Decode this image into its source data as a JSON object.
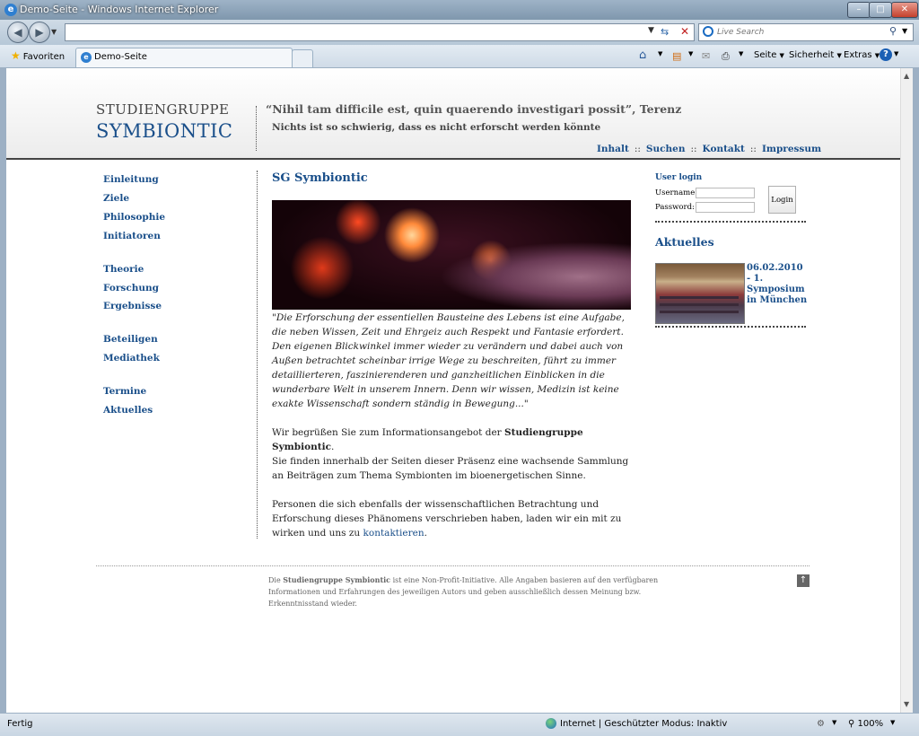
{
  "window": {
    "title": "Demo-Seite - Windows Internet Explorer",
    "search_placeholder": "Live Search",
    "favorites": "Favoriten",
    "tab_title": "Demo-Seite",
    "toolbar": {
      "seite": "Seite",
      "sicherheit": "Sicherheit",
      "extras": "Extras"
    },
    "status": {
      "left": "Fertig",
      "zone": "Internet | Geschützter Modus: Inaktiv",
      "zoom": "100%"
    }
  },
  "site": {
    "brand_top": "STUDIENGRUPPE",
    "brand_bottom": "SYMBIONTIC",
    "quote": "“Nihil tam difficile est, quin quaerendo investigari possit”, Terenz",
    "quote_translation": "Nichts ist so schwierig, dass es nicht erforscht werden könnte",
    "top_nav": [
      "Inhalt",
      "Suchen",
      "Kontakt",
      "Impressum"
    ],
    "top_nav_sep": "::"
  },
  "left_nav": {
    "group1": [
      "Einleitung",
      "Ziele",
      "Philosophie",
      "Initiatoren"
    ],
    "group2": [
      "Theorie",
      "Forschung",
      "Ergebnisse"
    ],
    "group3": [
      "Beteiligen",
      "Mediathek"
    ],
    "group4": [
      "Termine",
      "Aktuelles"
    ]
  },
  "content": {
    "title": "SG Symbiontic",
    "quote": "\"Die Erforschung der essentiellen Bausteine des Lebens ist eine Aufgabe, die neben Wissen, Zeit und Ehrgeiz auch Respekt und Fantasie erfordert. Den eigenen Blickwinkel immer wieder zu verändern und dabei auch von Außen betrachtet scheinbar irrige Wege zu beschreiten, führt zu immer detaillierteren, faszinierenderen und ganzheitlichen Einblicken in die wunderbare Welt in unserem Innern. Denn wir wissen, Medizin ist keine exakte Wissenschaft sondern ständig in Bewegung...\"",
    "welcome_pre": "Wir begrüßen Sie zum Informationsangebot der ",
    "welcome_bold": "Studiengruppe Symbiontic",
    "welcome_post": ".",
    "para2": "Sie finden innerhalb der Seiten dieser Präsenz eine wachsende Sammlung an Beiträgen zum Thema Symbionten im bioenergetischen Sinne.",
    "para3_pre": "Personen die sich ebenfalls der wissenschaftlichen Betrachtung und Erforschung dieses Phänomens verschrieben haben, laden wir ein mit zu wirken und uns zu ",
    "para3_link": "kontaktieren",
    "para3_post": "."
  },
  "login": {
    "title": "User login",
    "username_label": "Username:",
    "password_label": "Password:",
    "button": "Login"
  },
  "news": {
    "title": "Aktuelles",
    "item": "06.02.2010 - 1. Symposium in München"
  },
  "footer": {
    "pre": "Die ",
    "bold": "Studiengruppe Symbiontic",
    "post": " ist eine Non-Profit-Initiative. Alle Angaben basieren auf den verfügbaren Informationen und Erfahrungen des jeweiligen Autors und geben ausschließlich dessen Meinung bzw. Erkenntnisstand wieder."
  }
}
